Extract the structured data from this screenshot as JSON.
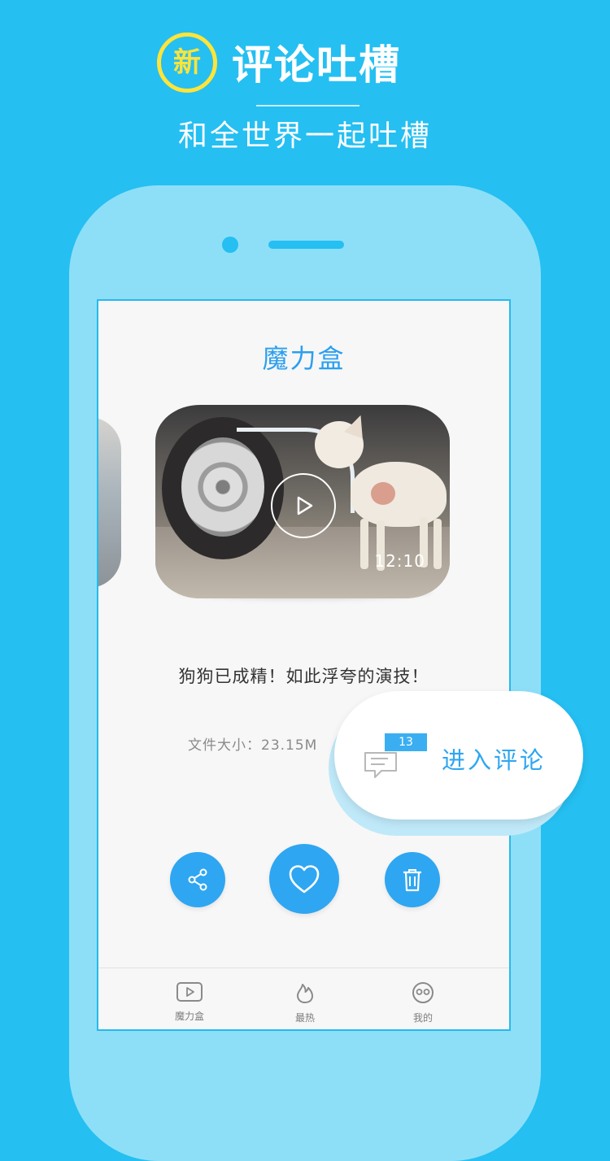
{
  "hero": {
    "badge": "新",
    "title": "评论吐槽",
    "subtitle": "和全世界一起吐槽"
  },
  "screen": {
    "title": "魔力盒",
    "video": {
      "duration": "12:10",
      "caption": "狗狗已成精！如此浮夸的演技！",
      "file_size": "文件大小：23.15M"
    },
    "actions": {
      "share_icon": "share-icon",
      "like_icon": "heart-icon",
      "delete_icon": "trash-icon"
    },
    "tabs": [
      {
        "label": "魔力盒",
        "icon": "video-icon"
      },
      {
        "label": "最热",
        "icon": "flame-icon"
      },
      {
        "label": "我的",
        "icon": "face-icon"
      }
    ]
  },
  "comment_popup": {
    "count": "13",
    "label": "进入评论"
  },
  "colors": {
    "background": "#25bff2",
    "phone": "#8ddff8",
    "accent": "#2fa6f1",
    "badge": "#ffe43a"
  }
}
